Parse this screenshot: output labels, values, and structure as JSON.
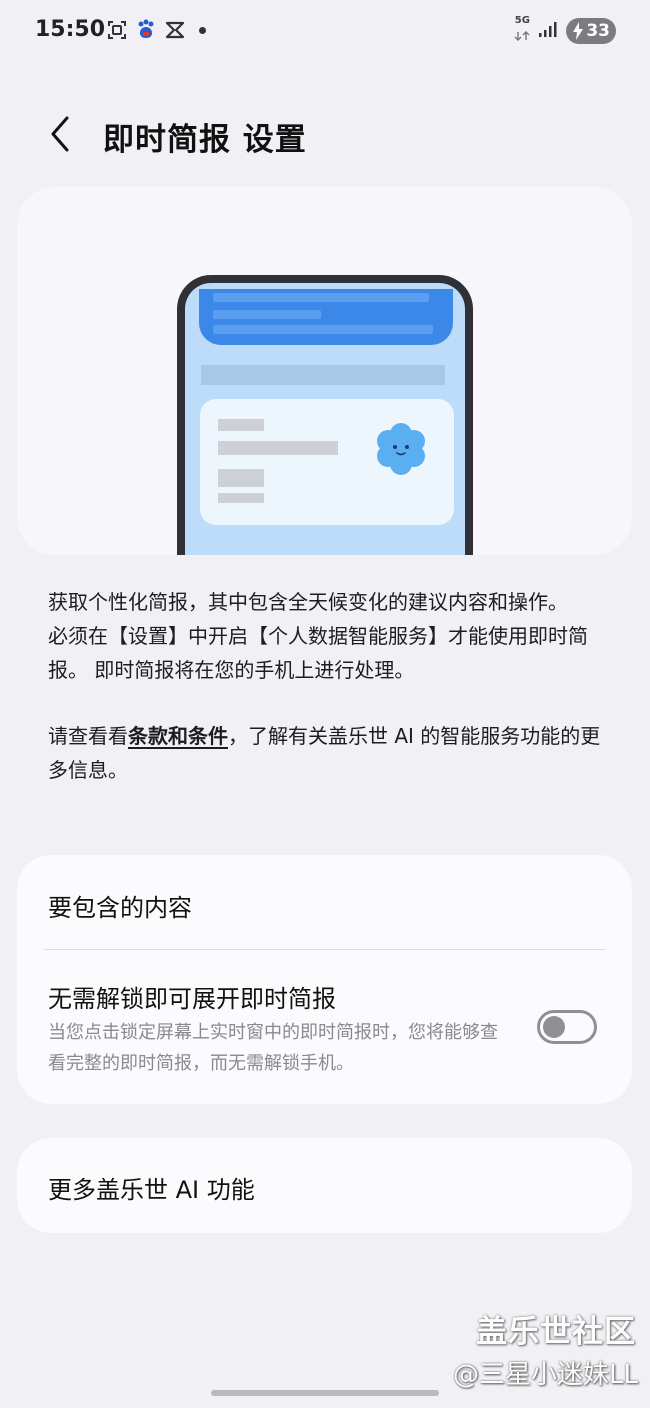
{
  "status_bar": {
    "time": "15:50",
    "network": "5G",
    "battery_level": "33",
    "icons": [
      "screenshot-icon",
      "baidu-icon",
      "capcut-icon",
      "notification-dot",
      "signal-icon",
      "battery-charging-icon"
    ]
  },
  "header": {
    "title": "即时简报 设置",
    "back_icon": "chevron-left-icon"
  },
  "description": {
    "line1": "获取个性化简报，其中包含全天候变化的建议内容和操作。",
    "line2": "必须在【设置】中开启【个人数据智能服务】才能使用即时简报。 即时简报将在您的手机上进行处理。",
    "terms_prefix": "请查看看",
    "terms_link": "条款和条件",
    "terms_suffix": "，了解有关盖乐世 AI 的智能服务功能的更多信息。"
  },
  "settings": {
    "content_label": "要包含的内容",
    "expand_title": "无需解锁即可展开即时简报",
    "expand_desc": "当您点击锁定屏幕上实时窗中的即时简报时，您将能够查看完整的即时简报，而无需解锁手机。",
    "expand_toggle_on": false
  },
  "more": {
    "label": "更多盖乐世 AI 功能"
  },
  "watermark": {
    "site": "盖乐世社区",
    "author": "@三星小迷妹LL"
  },
  "colors": {
    "background": "#f1f1f5",
    "card": "#fbfbfd",
    "phone_screen": "#bcdcfa",
    "banner_blue": "#3b88e8",
    "toggle_off": "#8f8f94"
  }
}
